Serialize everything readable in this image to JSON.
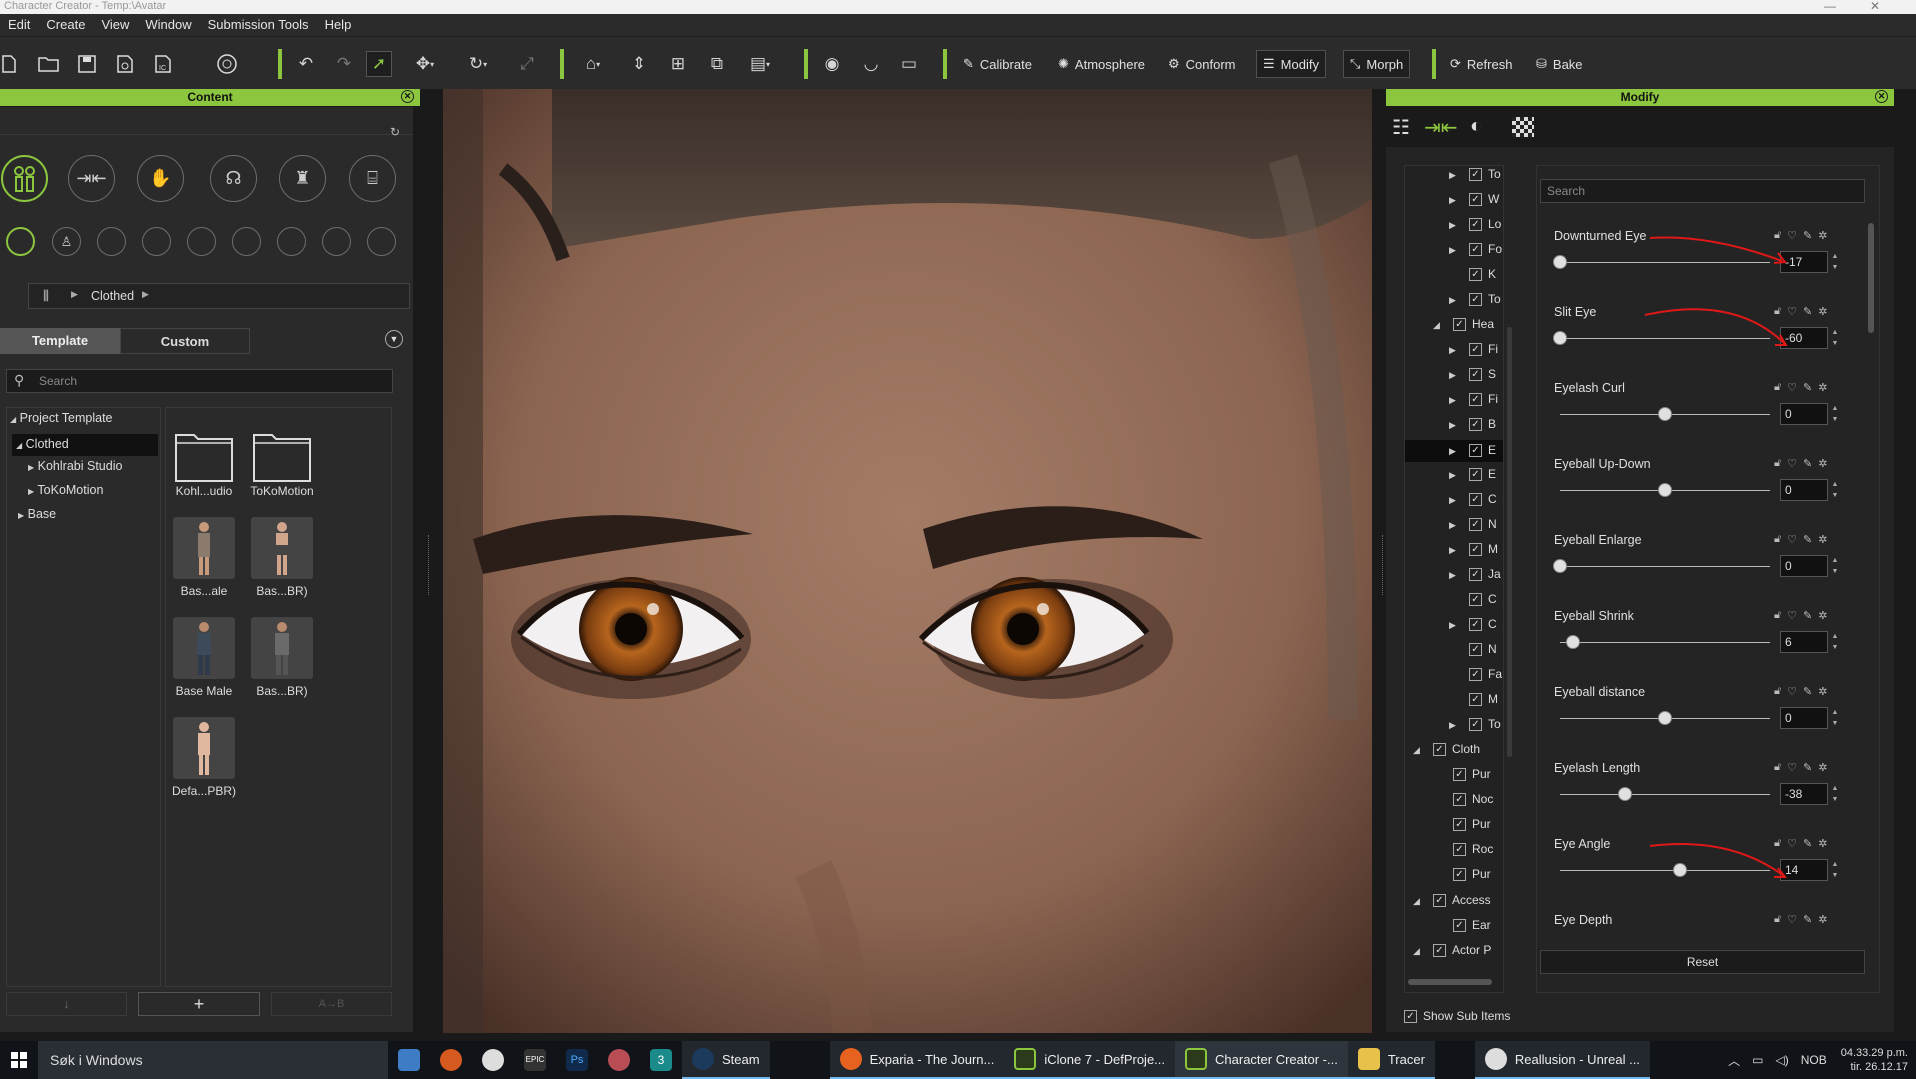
{
  "window": {
    "title": "Character Creator - Temp:\\Avatar"
  },
  "menu": [
    "Edit",
    "Create",
    "View",
    "Window",
    "Submission Tools",
    "Help"
  ],
  "toolbar": {
    "calibrate": "Calibrate",
    "atmosphere": "Atmosphere",
    "conform": "Conform",
    "modify": "Modify",
    "morph": "Morph",
    "refresh": "Refresh",
    "bake": "Bake",
    "accent": "#8cc63f"
  },
  "content": {
    "title": "Content",
    "breadcrumb": "Clothed",
    "tabs": [
      "Template",
      "Custom"
    ],
    "search_placeholder": "Search",
    "tree": [
      "Project Template",
      "Clothed",
      "Kohlrabi Studio",
      "ToKoMotion",
      "Base"
    ],
    "items": [
      "Kohl...udio",
      "ToKoMotion",
      "Bas...ale",
      "Bas...BR)",
      "Base Male",
      "Bas...BR)",
      "Defa...PBR)"
    ]
  },
  "modify": {
    "title": "Modify",
    "search_placeholder": "Search",
    "reset": "Reset",
    "show_sub_items": "Show Sub Items",
    "tree": [
      "To",
      "W",
      "Lo",
      "Fo",
      "K",
      "To",
      "Hea",
      "Fi",
      "S",
      "Fi",
      "B",
      "E",
      "E",
      "C",
      "N",
      "M",
      "Ja",
      "C",
      "C",
      "N",
      "Fa",
      "M",
      "To",
      "Cloth",
      "Pur",
      "Noc",
      "Pur",
      "Roc",
      "Pur",
      "Access",
      "Ear",
      "Actor P"
    ],
    "sliders": [
      {
        "label": "Downturned Eye",
        "value": "-17",
        "pos": 0
      },
      {
        "label": "Slit Eye",
        "value": "-60",
        "pos": 0
      },
      {
        "label": "Eyelash Curl",
        "value": "0",
        "pos": 0.5
      },
      {
        "label": "Eyeball Up-Down",
        "value": "0",
        "pos": 0.5
      },
      {
        "label": "Eyeball Enlarge",
        "value": "0",
        "pos": 0
      },
      {
        "label": "Eyeball Shrink",
        "value": "6",
        "pos": 0.06
      },
      {
        "label": "Eyeball distance",
        "value": "0",
        "pos": 0.5
      },
      {
        "label": "Eyelash Length",
        "value": "-38",
        "pos": 0.31
      },
      {
        "label": "Eye Angle",
        "value": "14",
        "pos": 0.57
      },
      {
        "label": "Eye Depth",
        "value": "",
        "pos": 0.5
      }
    ]
  },
  "taskbar": {
    "search": "Søk i Windows",
    "apps": [
      "Steam",
      "Exparia - The Journ...",
      "iClone 7 - DefProje...",
      "Character Creator -...",
      "Tracer",
      "Reallusion - Unreal ..."
    ],
    "lang": "NOB",
    "time": "04.33.29 p.m.",
    "date": "tir. 26.12.17"
  }
}
